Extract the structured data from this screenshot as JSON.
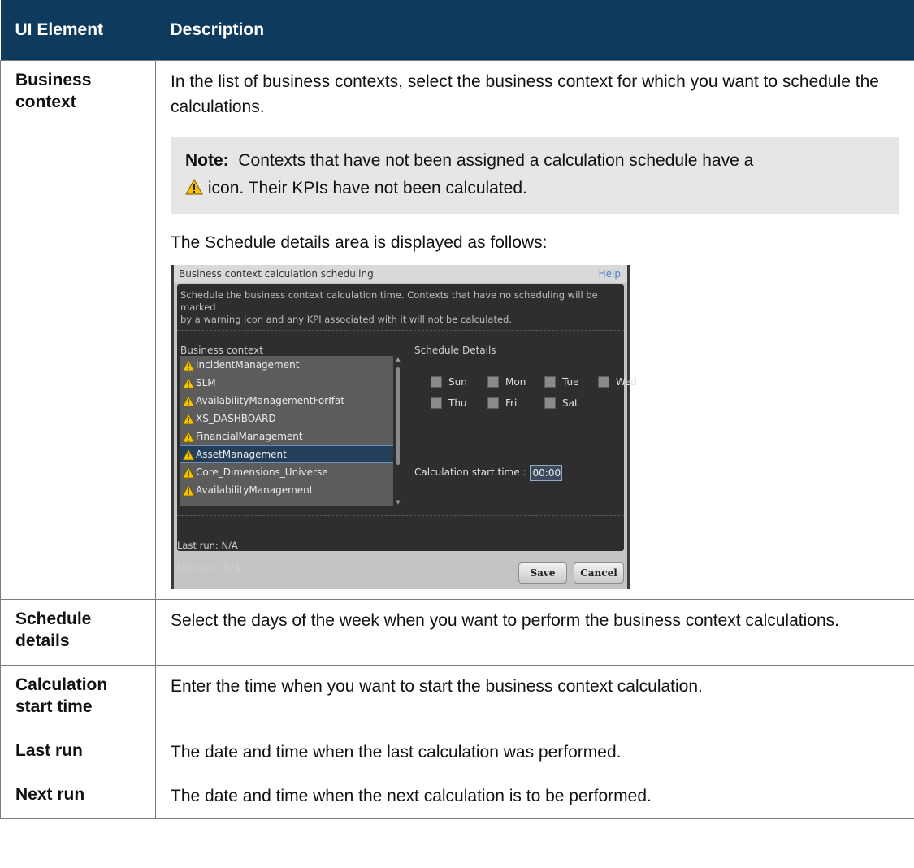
{
  "header": {
    "col1": "UI Element",
    "col2": "Description"
  },
  "rows": [
    {
      "element": "Business context",
      "description": "In the list of business contexts, select the business context for which you want to schedule the calculations.",
      "note_label": "Note:",
      "note_text_1": "Contexts that have not been assigned a calculation schedule have a",
      "note_text_2": "icon. Their KPIs have not been calculated.",
      "after_note": "The Schedule details area is displayed as follows:"
    },
    {
      "element": "Schedule details",
      "description": "Select the days of the week when you want to perform the business context calculations."
    },
    {
      "element": "Calculation start time",
      "description": "Enter the time when you want to start the business context calculation."
    },
    {
      "element": "Last run",
      "description": "The date and time when the last calculation was performed."
    },
    {
      "element": "Next run",
      "description": "The date and time when the next calculation is to be performed."
    }
  ],
  "screenshot": {
    "title": "Business context calculation scheduling",
    "help": "Help",
    "info_line1": "Schedule the business context calculation time. Contexts that have no scheduling will be marked",
    "info_line2": "by a warning icon and any KPI associated with it will not be calculated.",
    "business_context_label": "Business context",
    "schedule_details_label": "Schedule Details",
    "contexts": [
      "IncidentManagement",
      "SLM",
      "AvailabilityManagementForIfat",
      "XS_DASHBOARD",
      "FinancialManagement",
      "AssetManagement",
      "Core_Dimensions_Universe",
      "AvailabilityManagement"
    ],
    "selected_context": "AssetManagement",
    "days": [
      "Sun",
      "Mon",
      "Tue",
      "Wed",
      "Thu",
      "Fri",
      "Sat"
    ],
    "calc_start_label": "Calculation start time :",
    "calc_start_value": "00:00",
    "last_run": "Last run: N/A",
    "next_run": "Next run: N/A",
    "save": "Save",
    "cancel": "Cancel"
  },
  "colors": {
    "header_bg": "#0e3a5e",
    "note_bg": "#e6e6e6",
    "warning": "#f2c400",
    "selected": "#253e59"
  }
}
